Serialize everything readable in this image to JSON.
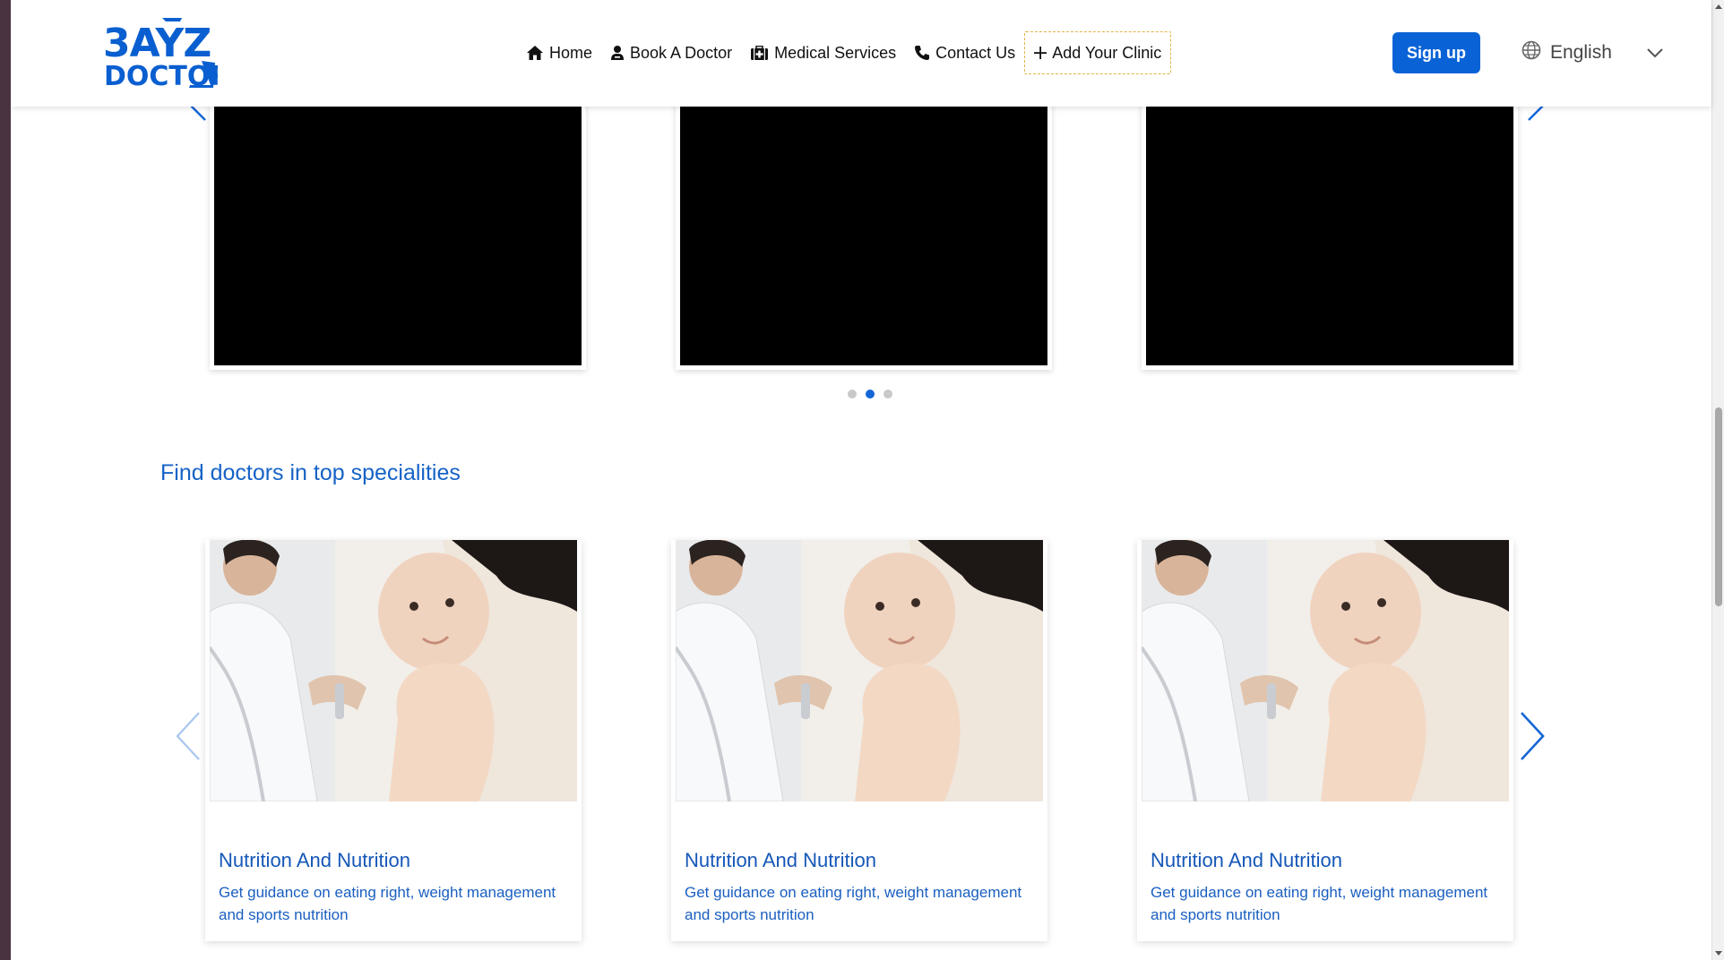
{
  "brand": {
    "logo_line1": "3AYZ",
    "logo_line2": "DOCTOR",
    "color": "#0a5fd0"
  },
  "nav": {
    "items": [
      {
        "label": "Home",
        "icon": "home-icon"
      },
      {
        "label": "Book A Doctor",
        "icon": "doctor-icon"
      },
      {
        "label": "Medical Services",
        "icon": "medical-kit-icon"
      },
      {
        "label": "Contact Us",
        "icon": "phone-icon"
      },
      {
        "label": "Add Your Clinic",
        "icon": "plus-icon"
      }
    ],
    "signup_label": "Sign up",
    "language": "English"
  },
  "video_carousel": {
    "cards": 3,
    "dots_total": 3,
    "active_dot": 2
  },
  "specialities": {
    "title": "Find doctors in top specialities",
    "cards": [
      {
        "title": "Nutrition And Nutrition",
        "description": "Get guidance on eating right, weight management and sports nutrition"
      },
      {
        "title": "Nutrition And Nutrition",
        "description": "Get guidance on eating right, weight management and sports nutrition"
      },
      {
        "title": "Nutrition And Nutrition",
        "description": "Get guidance on eating right, weight management and sports nutrition"
      }
    ]
  },
  "colors": {
    "accent": "#0a63d6",
    "link": "#1663c7",
    "clinic_border": "#e0b446"
  }
}
